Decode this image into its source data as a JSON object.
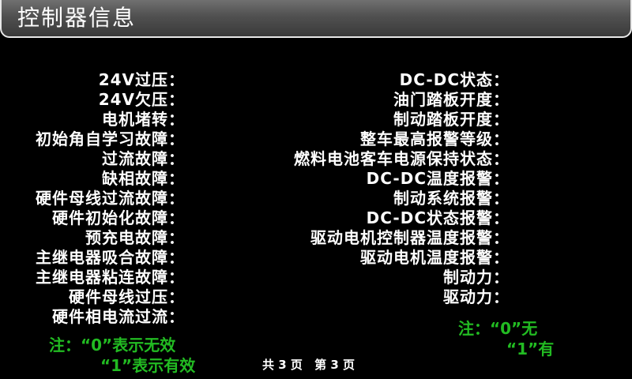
{
  "window": {
    "title": "控制器信息"
  },
  "left_fields": [
    "24V过压：",
    "24V欠压：",
    "电机堵转：",
    "初始角自学习故障：",
    "过流故障：",
    "缺相故障：",
    "硬件母线过流故障：",
    "硬件初始化故障：",
    "预充电故障：",
    "主继电器吸合故障：",
    "主继电器粘连故障：",
    "硬件母线过压：",
    "硬件相电流过流："
  ],
  "right_fields": [
    "DC-DC状态：",
    "油门踏板开度：",
    "制动踏板开度：",
    "整车最高报警等级：",
    "燃料电池客车电源保持状态：",
    "DC-DC温度报警：",
    "制动系统报警：",
    "DC-DC状态报警：",
    "驱动电机控制器温度报警：",
    "驱动电机温度报警：",
    "制动力：",
    "驱动力："
  ],
  "left_note": {
    "line1": "注：“0”表示无效",
    "line2": "“1”表示有效"
  },
  "right_note": {
    "line1": "注：“0”无",
    "line2": "“1”有"
  },
  "pager": {
    "total": "共 3 页",
    "current": "第 3 页"
  },
  "colors": {
    "background": "#000000",
    "text": "#ffffff",
    "note": "#22bb22",
    "title_bar": "#505050"
  }
}
